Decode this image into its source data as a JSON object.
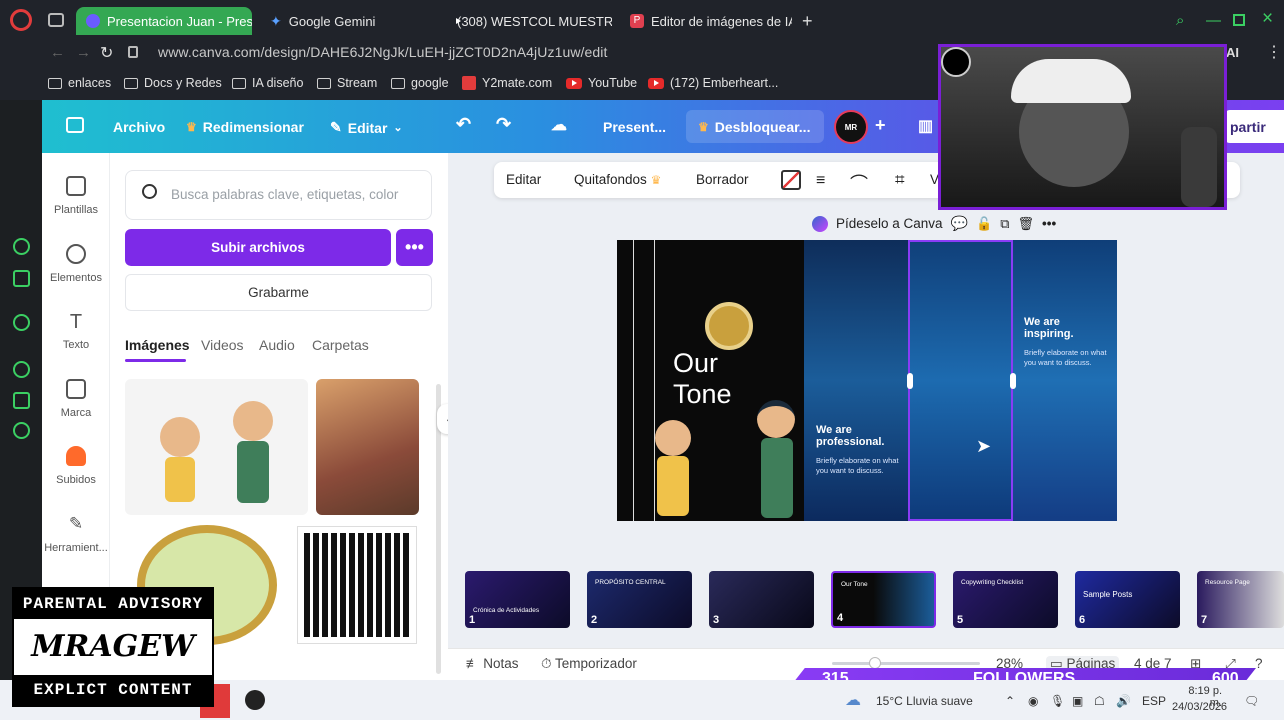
{
  "browser": {
    "tabs": [
      {
        "label": "Presentacion Juan - Prese",
        "active": true,
        "favicon_color": "#6a5cff"
      },
      {
        "label": "Google Gemini",
        "active": false,
        "favicon_color": "#4a90e2"
      },
      {
        "label": "(308) WESTCOL MUESTR",
        "active": false,
        "favicon_color": "#e52a2a"
      },
      {
        "label": "Editor de imágenes de IA",
        "active": false,
        "favicon_color": "#e04050"
      }
    ],
    "new_tab": "+",
    "url": "www.canva.com/design/DAHE6J2NgJk/LuEH-jjZCT0D2nA4jUz1uw/edit",
    "profile_label": "AI",
    "bookmarks": [
      {
        "label": "enlaces",
        "icon": "folder-icon"
      },
      {
        "label": "Docs y Redes",
        "icon": "folder-icon"
      },
      {
        "label": "IA diseño",
        "icon": "folder-icon"
      },
      {
        "label": "Stream",
        "icon": "folder-icon"
      },
      {
        "label": "google",
        "icon": "folder-icon"
      },
      {
        "label": "Y2mate.com",
        "icon": "y2mate-icon"
      },
      {
        "label": "YouTube",
        "icon": "youtube-icon"
      },
      {
        "label": "(172) Emberheart...",
        "icon": "youtube-icon"
      }
    ]
  },
  "canva_header": {
    "archivo": "Archivo",
    "redimensionar": "Redimensionar",
    "editar": "Editar",
    "title": "Present...",
    "desbloquear": "Desbloquear...",
    "avatar_text": "MR",
    "compartir": "partir"
  },
  "rail": [
    {
      "label": "Plantillas",
      "icon": "templates-icon"
    },
    {
      "label": "Elementos",
      "icon": "elements-icon"
    },
    {
      "label": "Texto",
      "icon": "text-icon"
    },
    {
      "label": "Marca",
      "icon": "brand-icon"
    },
    {
      "label": "Subidos",
      "icon": "uploads-icon"
    },
    {
      "label": "Herramient...",
      "icon": "tools-icon"
    }
  ],
  "panel": {
    "search_placeholder": "Busca palabras clave, etiquetas, color",
    "upload_button": "Subir archivos",
    "more_button": "•••",
    "record_button": "Grabarme",
    "tabs": [
      "Imágenes",
      "Videos",
      "Audio",
      "Carpetas"
    ]
  },
  "context_toolbar": {
    "editar": "Editar",
    "quitafondos": "Quitafondos",
    "borrador": "Borrador",
    "extra": "V"
  },
  "ai_bar": {
    "label": "Pídeselo a Canva"
  },
  "slide": {
    "title": "Our Tone",
    "col1_title": "We are professional.",
    "col1_body": "Briefly elaborate on what you want to discuss.",
    "col3_title": "We are inspiring.",
    "col3_body": "Briefly elaborate on what you want to discuss."
  },
  "thumbnails": [
    {
      "num": "1",
      "label": "Crónica de Actividades"
    },
    {
      "num": "2",
      "label": "PROPÓSITO CENTRAL"
    },
    {
      "num": "3",
      "label": ""
    },
    {
      "num": "4",
      "label": "Our Tone"
    },
    {
      "num": "5",
      "label": "Copywriting Checklist"
    },
    {
      "num": "6",
      "label": "Sample Posts"
    },
    {
      "num": "7",
      "label": "Resource Page"
    }
  ],
  "bottom_bar": {
    "notes": "Notas",
    "timer": "Temporizador",
    "zoom": "28%",
    "pages": "Páginas",
    "page_count": "4 de 7"
  },
  "followers": {
    "current": "315",
    "label": "FOLLOWERS",
    "goal": "600"
  },
  "taskbar": {
    "weather": "15°C  Lluvia suave",
    "lang": "ESP",
    "time": "8:19 p. m.",
    "date": "24/03/2026"
  },
  "overlay": {
    "parental": "PARENTAL ADVISORY",
    "brand": "MRAGEW",
    "explicit": "EXPLICT  CONTENT"
  },
  "colors": {
    "canva_purple": "#7d2ae8",
    "chrome_green": "#34a853",
    "followers": "#8a3cf5"
  }
}
